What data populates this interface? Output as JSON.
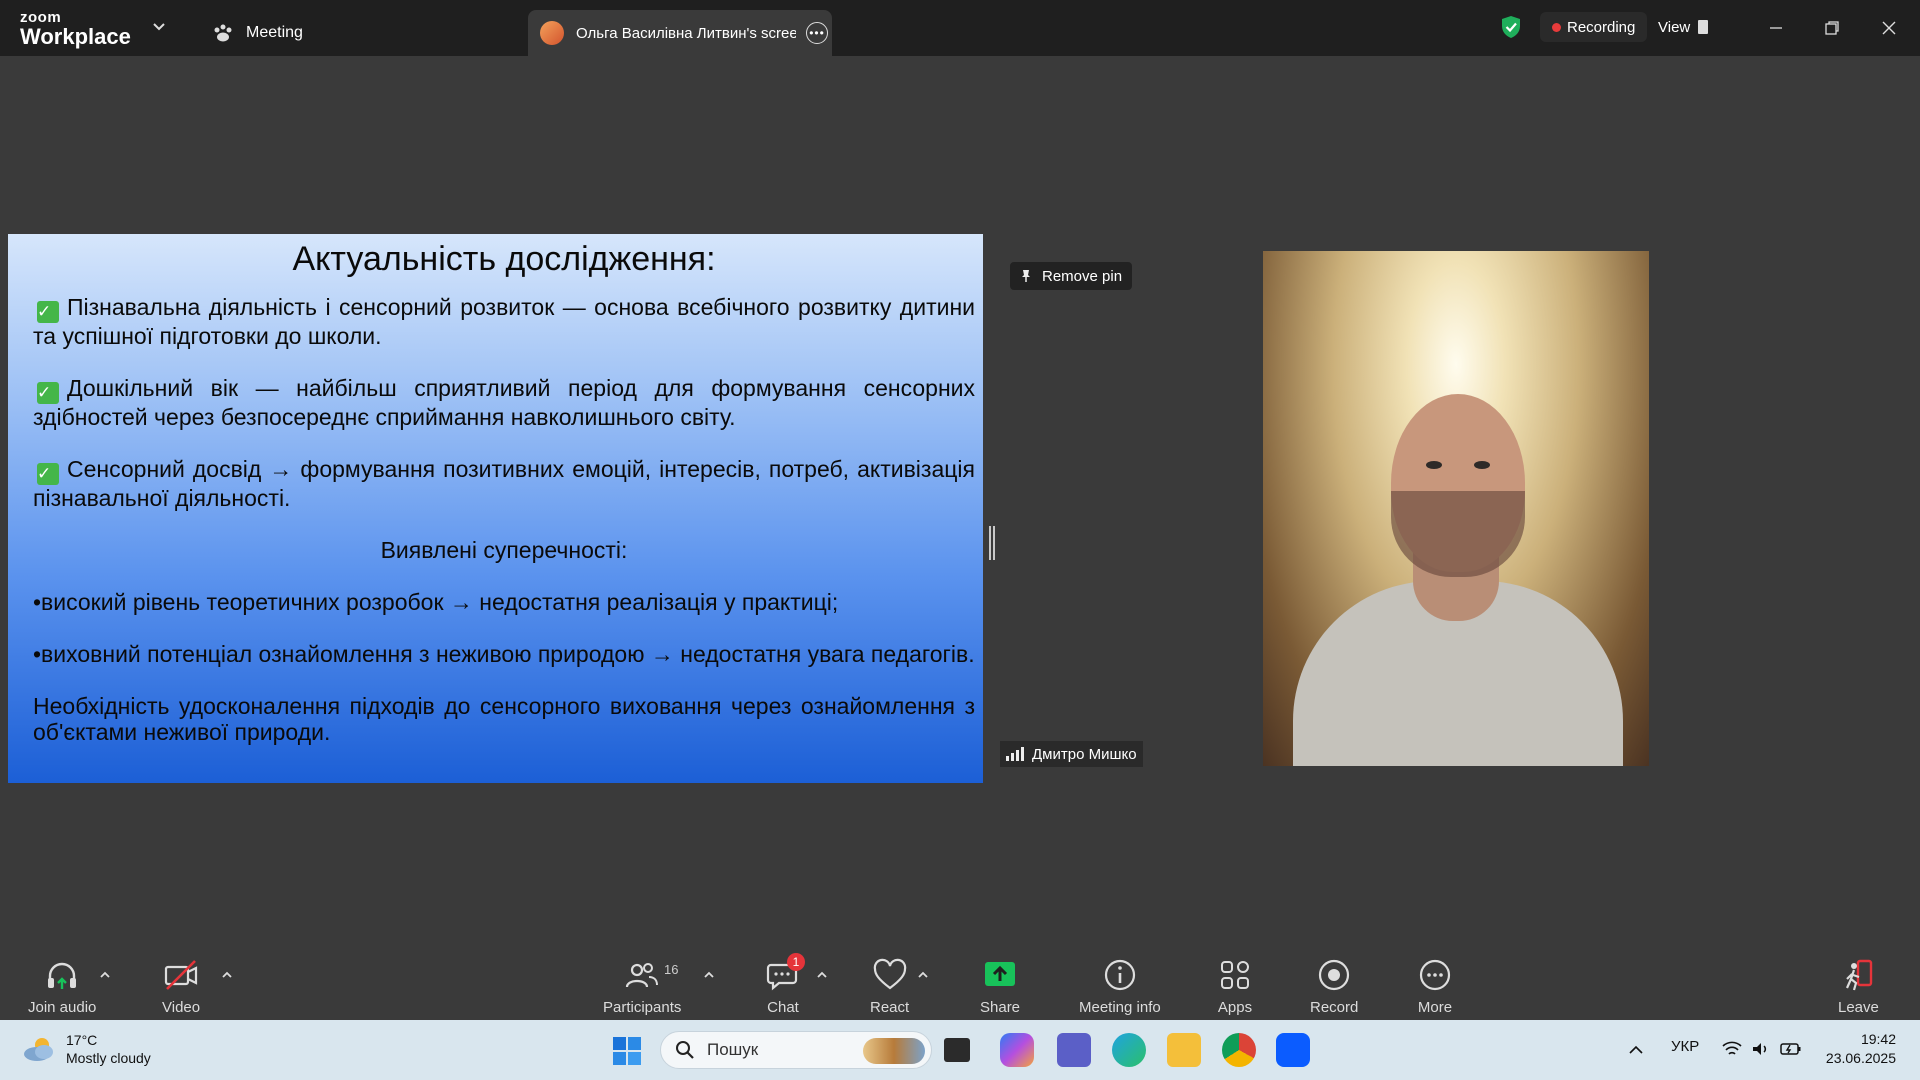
{
  "titlebar": {
    "brand_small": "zoom",
    "brand_big": "Workplace",
    "tab_meeting": "Meeting",
    "tab_share": "Ольга Василівна Литвин's screen",
    "recording_label": "Recording",
    "view_label": "View"
  },
  "slide": {
    "title": "Актуальність дослідження:",
    "point1": "Пізнавальна діяльність і сенсорний розвиток — основа всебічного розвитку дитини та успішної підготовки до школи.",
    "point2": "Дошкільний вік — найбільш сприятливий період для формування сенсорних здібностей через безпосереднє сприймання навколишнього світу.",
    "point3": "Сенсорний досвід → формування позитивних емоцій, інтересів, потреб, активізація пізнавальної діяльності.",
    "subheading": "Виявлені суперечності:",
    "contradiction1": "•високий рівень теоретичних розробок → недостатня реалізація у практиці;",
    "contradiction2": "•виховний потенціал ознайомлення з неживою природою → недостатня увага педагогів.",
    "conclusion": "Необхідність удосконалення підходів до сенсорного виховання через ознайомлення з об'єктами неживої природи."
  },
  "video": {
    "remove_pin": "Remove pin",
    "participant_name": "Дмитро Мишко"
  },
  "toolbar": {
    "join_audio": "Join audio",
    "video": "Video",
    "participants": "Participants",
    "participants_count": "16",
    "chat": "Chat",
    "chat_badge": "1",
    "react": "React",
    "share": "Share",
    "meeting_info": "Meeting info",
    "apps": "Apps",
    "record": "Record",
    "more": "More",
    "leave": "Leave"
  },
  "taskbar": {
    "temperature": "17°C",
    "weather": "Mostly cloudy",
    "search_placeholder": "Пошук",
    "language": "УКР",
    "time": "19:42",
    "date": "23.06.2025"
  },
  "colors": {
    "titlebar_bg": "#1f1f1f",
    "stage_bg": "#3a3a3a",
    "share_green": "#18c25a",
    "recording_red": "#e83b3b",
    "badge_red": "#e5343a"
  }
}
